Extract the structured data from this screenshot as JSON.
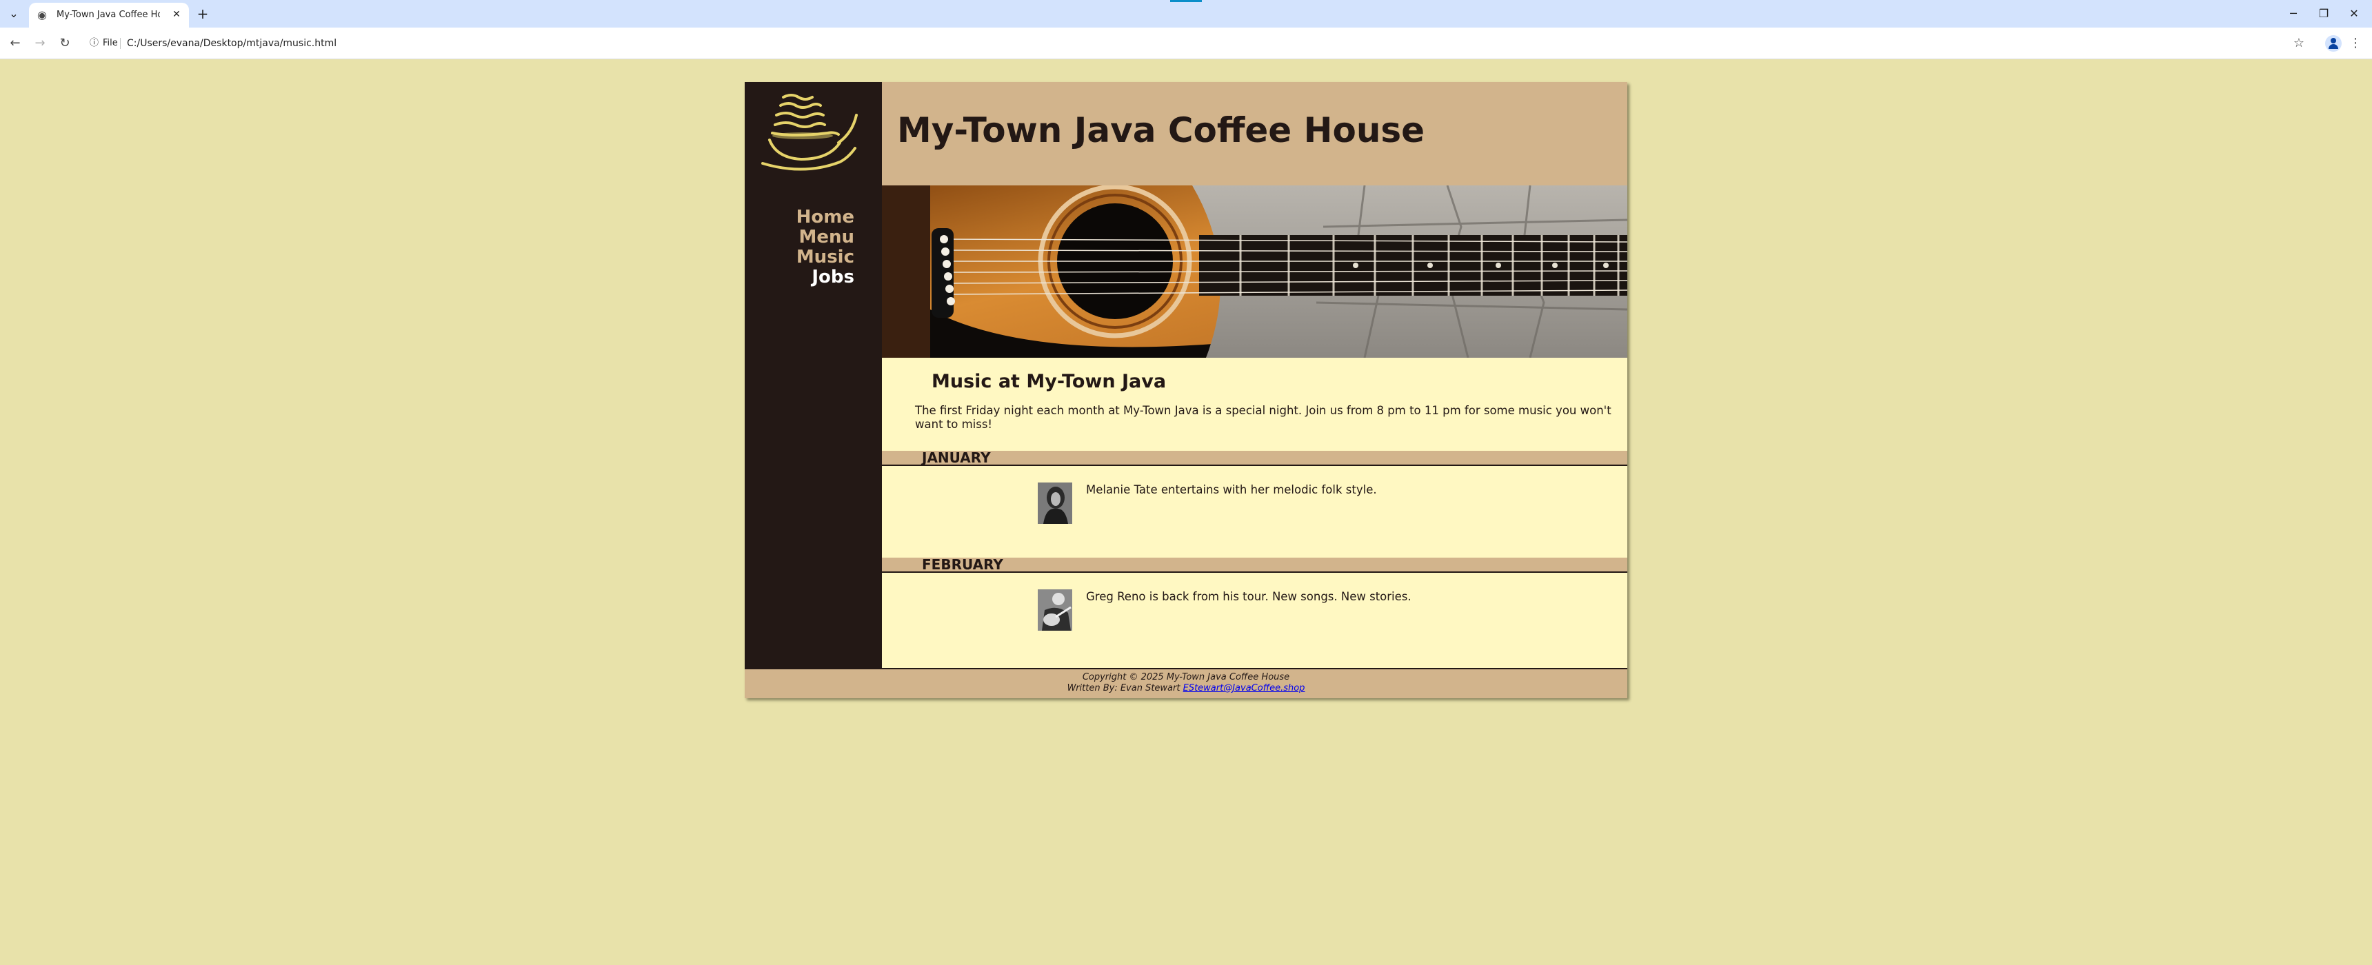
{
  "browser": {
    "tab_title": "My-Town Java Coffee House M",
    "file_chip": "File",
    "url": "C:/Users/evana/Desktop/mtjava/music.html"
  },
  "site": {
    "title": "My-Town Java Coffee House",
    "nav": [
      "Home",
      "Menu",
      "Music",
      "Jobs"
    ]
  },
  "content": {
    "heading": "Music at My-Town Java",
    "intro": "The first Friday night each month at My-Town Java is a special night. Join us from 8 pm to 11 pm for some music you won't want to miss!",
    "months": [
      {
        "name": "JANUARY",
        "text": "Melanie Tate entertains with her melodic folk style."
      },
      {
        "name": "FEBRUARY",
        "text": "Greg Reno is back from his tour. New songs. New stories."
      }
    ]
  },
  "footer": {
    "copyright": "Copyright © 2025 My-Town Java Coffee House",
    "written_by": "Written By: Evan Stewart",
    "email": "EStewart@JavaCoffee.shop"
  },
  "colors": {
    "page_bg": "#e8e2aa",
    "sidebar": "#231815",
    "header": "#d2b48c",
    "content_bg": "#fff8c2",
    "link": "#0000ee"
  },
  "icons": [
    "chevron-down-icon",
    "globe-icon",
    "close-icon",
    "plus-icon",
    "minimize-icon",
    "restore-icon",
    "back-arrow-icon",
    "forward-arrow-icon",
    "reload-icon",
    "info-icon",
    "star-icon",
    "profile-icon",
    "kebab-menu-icon",
    "coffee-cup-logo"
  ]
}
